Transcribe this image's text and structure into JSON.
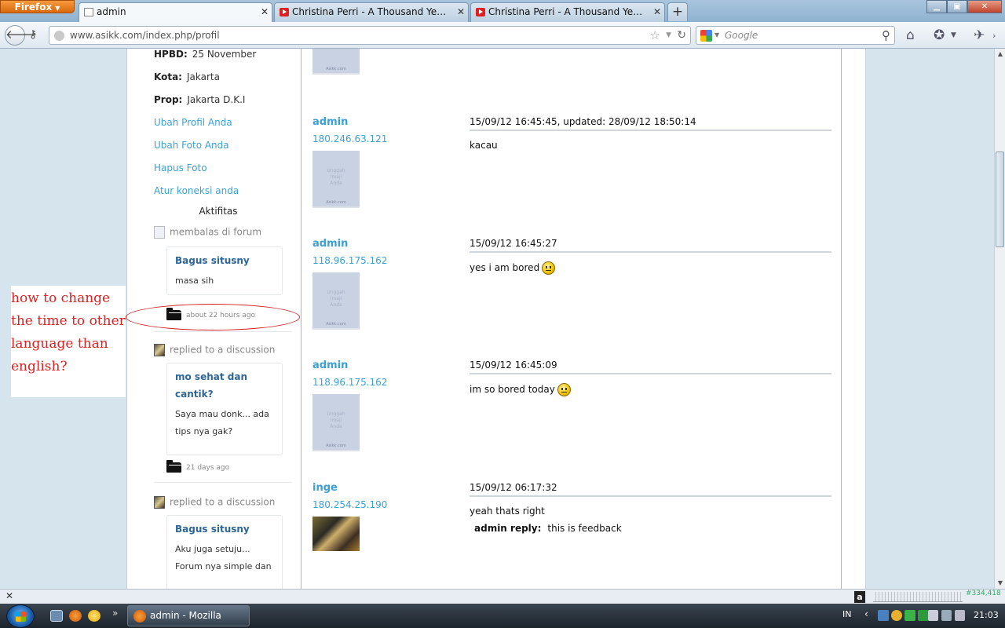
{
  "browser": {
    "app_button": "Firefox",
    "tabs": [
      {
        "label": "admin",
        "icon": "page-icon",
        "active": true
      },
      {
        "label": "Christina Perri - A Thousand Years (Pi...",
        "icon": "youtube-icon",
        "active": false
      },
      {
        "label": "Christina Perri - A Thousand Years (O...",
        "icon": "youtube-icon",
        "active": false
      }
    ],
    "new_tab_label": "+",
    "url": "www.asikk.com/index.php/profil",
    "search_placeholder": "Google"
  },
  "profile": {
    "fields": [
      {
        "label": "HPBD:",
        "value": "25 November"
      },
      {
        "label": "Kota:",
        "value": "Jakarta"
      },
      {
        "label": "Prop:",
        "value": "Jakarta D.K.I"
      }
    ],
    "links": [
      "Ubah Profil Anda",
      "Ubah Foto Anda",
      "Hapus Foto",
      "Atur koneksi anda"
    ],
    "activity_heading": "Aktifitas",
    "activities": [
      {
        "action": "membalas di forum",
        "title": "Bagus situsny",
        "body": "masa sih",
        "time": "about 22 hours ago"
      },
      {
        "action": "replied to a discussion",
        "title": "mo sehat dan cantik?",
        "body": "Saya mau donk... ada tips nya gak?",
        "time": "21 days ago"
      },
      {
        "action": "replied to a discussion",
        "title": "Bagus situsny",
        "body": "Aku juga setuju... Forum nya simple dan"
      }
    ]
  },
  "posts": [
    {
      "user": "admin",
      "ip": "180.246.63.121",
      "time": "15/09/12 16:45:45, updated: 28/09/12 18:50:14",
      "message": "kacau",
      "smiley": false
    },
    {
      "user": "admin",
      "ip": "118.96.175.162",
      "time": "15/09/12 16:45:27",
      "message": "yes i am bored",
      "smiley": true
    },
    {
      "user": "admin",
      "ip": "118.96.175.162",
      "time": "15/09/12 16:45:09",
      "message": "im so bored today",
      "smiley": true
    },
    {
      "user": "inge",
      "ip": "180.254.25.190",
      "time": "15/09/12 06:17:32",
      "message": "yeah thats right",
      "reply_label": "admin reply:",
      "reply_text": "this is feedback",
      "photo": true
    }
  ],
  "placeholder_photo": {
    "text_lines": [
      "Unggah",
      "Imaji",
      "Anda"
    ],
    "brand": "Asikk.com"
  },
  "annotation": {
    "lines": [
      "how to change",
      "the time to other",
      "language than",
      "english?"
    ],
    "color": "#e02020"
  },
  "addon_bar": {
    "rank": "#334,418",
    "accessibility_glyph": "a"
  },
  "taskbar": {
    "window_title": "admin - Mozilla Fire...",
    "language": "IN",
    "clock": "21:03"
  }
}
